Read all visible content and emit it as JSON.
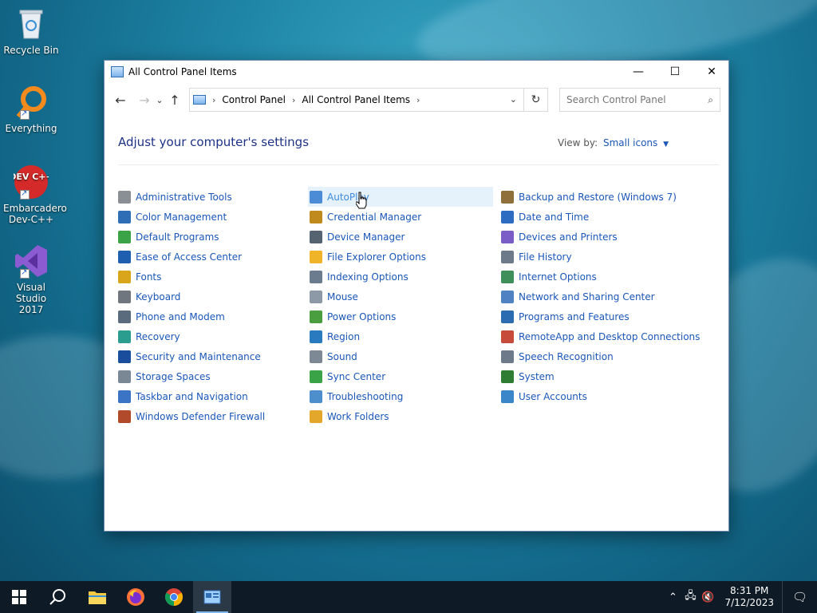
{
  "desktop": {
    "icons": [
      {
        "label": "Recycle Bin"
      },
      {
        "label": "Everything"
      },
      {
        "label": "Embarcadero Dev-C++",
        "glyph": "DEV C++"
      },
      {
        "label": "Visual Studio 2017"
      }
    ]
  },
  "window": {
    "title": "All Control Panel Items",
    "minimize": "—",
    "maximize": "☐",
    "close": "✕"
  },
  "navbar": {
    "back": "←",
    "forward": "→",
    "recent": "⌄",
    "up": "↑",
    "breadcrumb": [
      "Control Panel",
      "All Control Panel Items"
    ],
    "search_placeholder": "Search Control Panel"
  },
  "content": {
    "heading": "Adjust your computer's settings",
    "view_by_label": "View by:",
    "view_by_value": "Small icons",
    "columns": [
      [
        "Administrative Tools",
        "Color Management",
        "Default Programs",
        "Ease of Access Center",
        "Fonts",
        "Keyboard",
        "Phone and Modem",
        "Recovery",
        "Security and Maintenance",
        "Storage Spaces",
        "Taskbar and Navigation",
        "Windows Defender Firewall"
      ],
      [
        "AutoPlay",
        "Credential Manager",
        "Device Manager",
        "File Explorer Options",
        "Indexing Options",
        "Mouse",
        "Power Options",
        "Region",
        "Sound",
        "Sync Center",
        "Troubleshooting",
        "Work Folders"
      ],
      [
        "Backup and Restore (Windows 7)",
        "Date and Time",
        "Devices and Printers",
        "File History",
        "Internet Options",
        "Network and Sharing Center",
        "Programs and Features",
        "RemoteApp and Desktop Connections",
        "Speech Recognition",
        "System",
        "User Accounts"
      ]
    ],
    "hovered_item": "AutoPlay"
  },
  "taskbar": {
    "time": "8:31 PM",
    "date": "7/12/2023"
  },
  "colors": {
    "link": "#1a56b8",
    "heading": "#1e3287",
    "taskbar": "#0e1a26"
  }
}
